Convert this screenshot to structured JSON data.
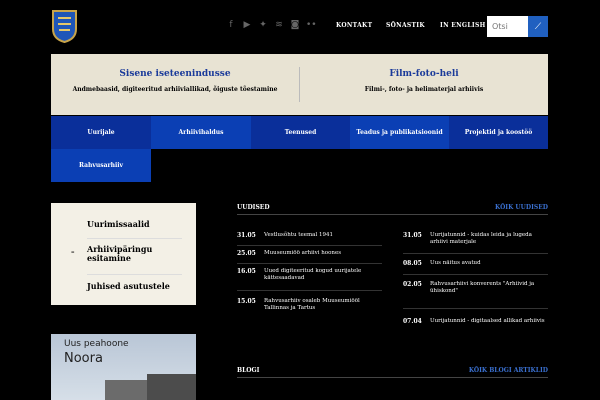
{
  "header": {
    "logo_icon": "coat-of-arms-icon",
    "social_icons": [
      "facebook-icon",
      "youtube-icon",
      "twitter-icon",
      "rss-icon",
      "instagram-icon",
      "flickr-icon"
    ],
    "nav": [
      "Kontakt",
      "Sõnastik",
      "In English"
    ],
    "search_placeholder": "Otsi",
    "search_button_icon": "search-icon"
  },
  "promo": [
    {
      "title": "Sisene iseteenindusse",
      "subtitle": "Andmebaasid, digiteeritud arhiiviallikad, õiguste tõestamine"
    },
    {
      "title": "Film-foto-heli",
      "subtitle": "Filmi-, foto- ja helimaterjal arhiivis"
    }
  ],
  "mainnav": [
    "Uurijale",
    "Arhiivihaldus",
    "Teenused",
    "Teadus ja publikatsioonid",
    "Projektid ja koostöö",
    "Rahvusarhiiv"
  ],
  "sidemenu": [
    "Uurimissaalid",
    "Arhiivipäringu esitamine",
    "Juhised asutustele"
  ],
  "photo": {
    "line1": "Uus peahoone",
    "line2": "Noora"
  },
  "news": {
    "heading": "Uudised",
    "all_link": "Kõik uudised",
    "items_left": [
      {
        "date": "31.05",
        "text": "Vestlusõhtu teemal 1941"
      },
      {
        "date": "25.05",
        "text": "Muuseumiöö arhiivi hoones"
      },
      {
        "date": "16.05",
        "text": "Uued digiteeritud kogud uurijatele kättesaadavad"
      },
      {
        "date": "15.05",
        "text": "Rahvusarhiiv osaleb Muuseumiööl Tallinnas ja Tartus"
      }
    ],
    "items_right": [
      {
        "date": "31.05",
        "text": "Uurijatunnid - kuidas leida ja lugeda arhiivi materjale"
      },
      {
        "date": "08.05",
        "text": "Uus näitus avatud"
      },
      {
        "date": "02.05",
        "text": "Rahvusarhiivi konverents \"Arhiivid ja ühiskond\""
      },
      {
        "date": "07.04",
        "text": "Uurijatunnid - digitaalsed allikad arhiivis"
      }
    ]
  },
  "blog": {
    "heading": "Blogi",
    "all_link": "Kõik blogi artiklid"
  },
  "colors": {
    "accent_blue": "#1a3a9a",
    "link_blue": "#3a70d0",
    "nav_dark": "#0a2a8a",
    "nav_mid": "#1040b0",
    "promo_bg": "#e8e3d3"
  }
}
